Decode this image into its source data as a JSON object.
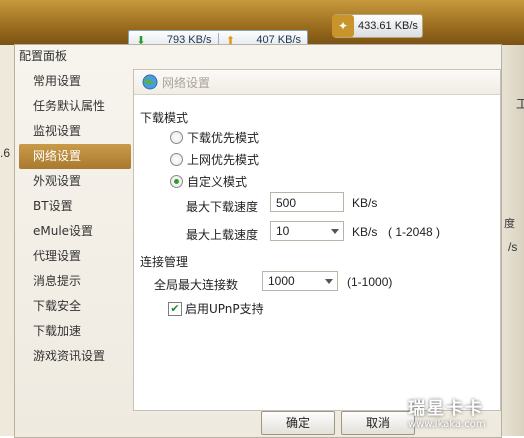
{
  "speed_bar": {
    "download_speed": "793 KB/s",
    "upload_speed": "407 KB/s",
    "total_speed": "433.61 KB/s"
  },
  "background": {
    "left_text": ".6",
    "right_text_1": "工",
    "right_text_2": "度",
    "right_text_3": "/s"
  },
  "dialog": {
    "title": "配置面板",
    "nav_items": [
      {
        "label": "常用设置"
      },
      {
        "label": "任务默认属性"
      },
      {
        "label": "监视设置"
      },
      {
        "label": "网络设置"
      },
      {
        "label": "外观设置"
      },
      {
        "label": "BT设置"
      },
      {
        "label": "eMule设置"
      },
      {
        "label": "代理设置"
      },
      {
        "label": "消息提示"
      },
      {
        "label": "下载安全"
      },
      {
        "label": "下载加速"
      },
      {
        "label": "游戏资讯设置"
      }
    ],
    "selected_nav": "网络设置",
    "panel": {
      "title": "网络设置",
      "download_mode": {
        "section_title": "下载模式",
        "options": [
          "下载优先模式",
          "上网优先模式",
          "自定义模式"
        ],
        "selected": "自定义模式",
        "max_download_label": "最大下载速度",
        "max_download_value": "500",
        "max_download_unit": "KB/s",
        "max_upload_label": "最大上载速度",
        "max_upload_value": "10",
        "max_upload_unit": "KB/s",
        "max_upload_range": "( 1-2048 )"
      },
      "connection": {
        "section_title": "连接管理",
        "max_conn_label": "全局最大连接数",
        "max_conn_value": "1000",
        "max_conn_range": "(1-1000)",
        "upnp_label": "启用UPnP支持",
        "upnp_checked": true
      }
    },
    "buttons": {
      "ok": "确定",
      "cancel": "取消"
    }
  },
  "watermark": {
    "line1": "瑞星卡卡",
    "line2": "www.ikaka.com"
  }
}
